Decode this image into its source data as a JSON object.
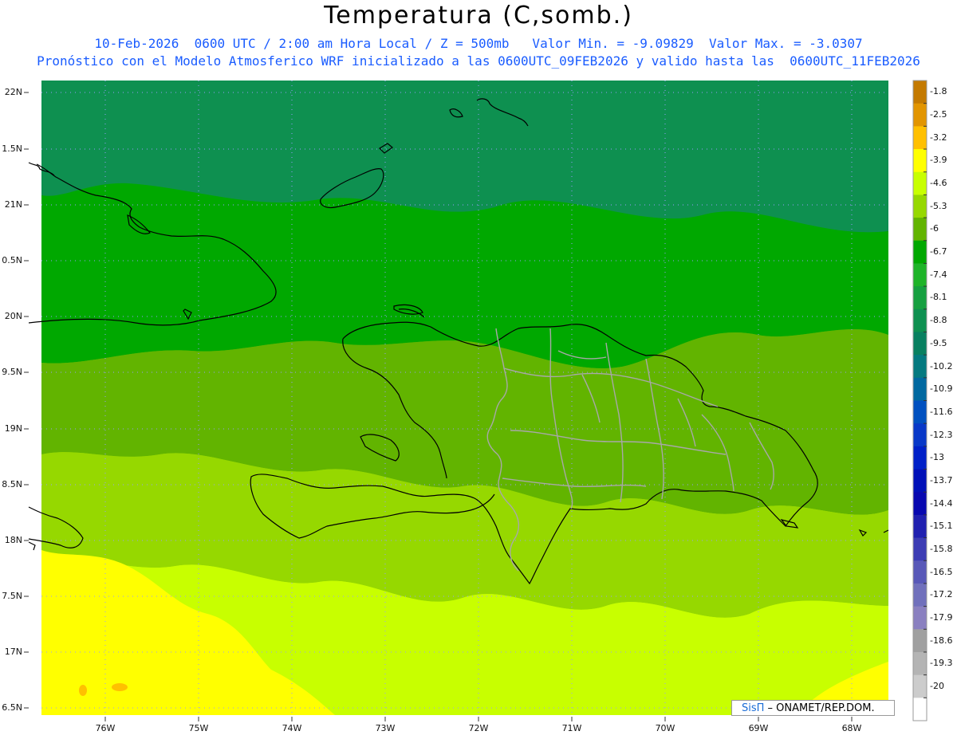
{
  "header": {
    "title": "Temperatura (C,somb.)",
    "line1": "10-Feb-2026  0600 UTC / 2:00 am Hora Local / Z = 500mb   Valor Min. = -9.09829  Valor Max. = -3.0307",
    "line2": "Pronóstico con el Modelo Atmosferico WRF inicializado a las 0600UTC_09FEB2026 y valido hasta las  0600UTC_11FEB2026"
  },
  "axes": {
    "lat_labels": [
      "22N",
      "1.5N",
      "21N",
      "0.5N",
      "20N",
      "9.5N",
      "19N",
      "8.5N",
      "18N",
      "7.5N",
      "17N",
      "6.5N"
    ],
    "lon_labels": [
      "76W",
      "75W",
      "74W",
      "73W",
      "72W",
      "71W",
      "70W",
      "69W",
      "68W"
    ]
  },
  "colorbar": {
    "labels": [
      "-1.8",
      "-2.5",
      "-3.2",
      "-3.9",
      "-4.6",
      "-5.3",
      "-6",
      "-6.7",
      "-7.4",
      "-8.1",
      "-8.8",
      "-9.5",
      "-10.2",
      "-10.9",
      "-11.6",
      "-12.3",
      "-13",
      "-13.7",
      "-14.4",
      "-15.1",
      "-15.8",
      "-16.5",
      "-17.2",
      "-17.9",
      "-18.6",
      "-19.3",
      "-20"
    ],
    "colors": [
      "#c47a00",
      "#e29500",
      "#ffc000",
      "#ffff00",
      "#c8ff00",
      "#96d800",
      "#62b400",
      "#00a800",
      "#1eb428",
      "#16a040",
      "#0e9050",
      "#088060",
      "#047a80",
      "#0068a0",
      "#0050c0",
      "#0838c8",
      "#0020c8",
      "#0010b8",
      "#0808b0",
      "#2020b0",
      "#3c3cb4",
      "#5858b8",
      "#7070bc",
      "#8a80c0",
      "#a0a0a0",
      "#b4b4b4",
      "#cccccc",
      "#ffffff"
    ]
  },
  "map": {
    "field_colors": {
      "north": "#16a040",
      "north_mid": "#00a800",
      "mid": "#62b400",
      "south_mid": "#96d800",
      "south": "#c8ff00",
      "far_south": "#ffff00",
      "warm_patch": "#ffc000"
    },
    "coast_color": "#000000",
    "border_color": "#a8a8a8"
  },
  "footer": {
    "credit_brand": "SisΠ",
    "credit_text": " – ONAMET/REP.DOM."
  }
}
